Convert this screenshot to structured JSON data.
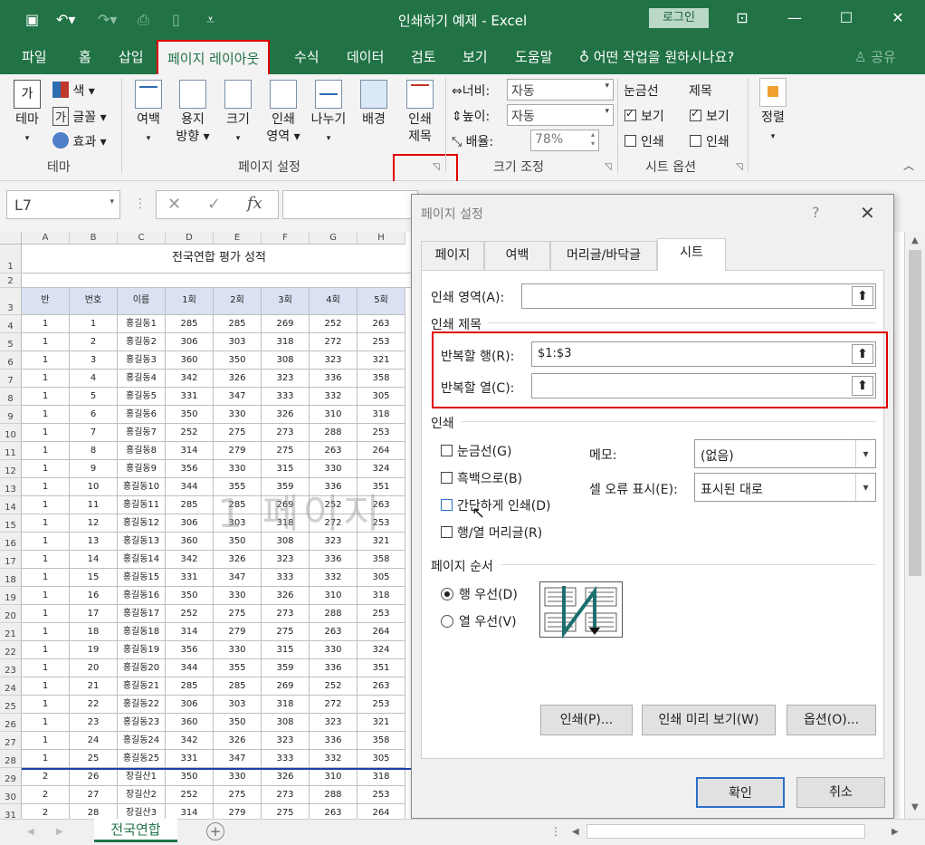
{
  "app": {
    "window_title": "인쇄하기 예제  -  Excel",
    "login": "로그인",
    "share": "공유"
  },
  "menu": {
    "tabs": [
      "파일",
      "홈",
      "삽입",
      "페이지 레이아웃",
      "수식",
      "데이터",
      "검토",
      "보기",
      "도움말"
    ],
    "tell_me": "어떤 작업을 원하시나요?"
  },
  "ribbon": {
    "theme": {
      "big": "테마",
      "color": "색",
      "font": "글꼴",
      "effect": "효과",
      "group": "테마",
      "font_glyph": "가"
    },
    "page_setup": {
      "margins": "여백",
      "orient_1": "용지",
      "orient_2": "방향",
      "size": "크기",
      "print_area_1": "인쇄",
      "print_area_2": "영역",
      "breaks": "나누기",
      "background": "배경",
      "titles_1": "인쇄",
      "titles_2": "제목",
      "group": "페이지 설정"
    },
    "scale": {
      "width_label": "너비:",
      "width_value": "자동",
      "height_label": "높이:",
      "height_value": "자동",
      "scale_label": "배율:",
      "scale_value": "78%",
      "group": "크기 조정"
    },
    "sheet_options": {
      "gridlines": "눈금선",
      "headings": "제목",
      "view": "보기",
      "print": "인쇄",
      "group": "시트 옵션"
    },
    "arrange": {
      "label": "정렬"
    }
  },
  "formula": {
    "name_box": "L7",
    "fx": "fx"
  },
  "sheet": {
    "columns": [
      "A",
      "B",
      "C",
      "D",
      "E",
      "F",
      "G",
      "H"
    ],
    "title": "전국연합 평가 성적",
    "headers": [
      "반",
      "번호",
      "이름",
      "1회",
      "2회",
      "3회",
      "4회",
      "5회"
    ],
    "rows": [
      [
        "1",
        "1",
        "홍길동1",
        "285",
        "285",
        "269",
        "252",
        "263"
      ],
      [
        "1",
        "2",
        "홍길동2",
        "306",
        "303",
        "318",
        "272",
        "253"
      ],
      [
        "1",
        "3",
        "홍길동3",
        "360",
        "350",
        "308",
        "323",
        "321"
      ],
      [
        "1",
        "4",
        "홍길동4",
        "342",
        "326",
        "323",
        "336",
        "358"
      ],
      [
        "1",
        "5",
        "홍길동5",
        "331",
        "347",
        "333",
        "332",
        "305"
      ],
      [
        "1",
        "6",
        "홍길동6",
        "350",
        "330",
        "326",
        "310",
        "318"
      ],
      [
        "1",
        "7",
        "홍길동7",
        "252",
        "275",
        "273",
        "288",
        "253"
      ],
      [
        "1",
        "8",
        "홍길동8",
        "314",
        "279",
        "275",
        "263",
        "264"
      ],
      [
        "1",
        "9",
        "홍길동9",
        "356",
        "330",
        "315",
        "330",
        "324"
      ],
      [
        "1",
        "10",
        "홍길동10",
        "344",
        "355",
        "359",
        "336",
        "351"
      ],
      [
        "1",
        "11",
        "홍길동11",
        "285",
        "285",
        "269",
        "252",
        "263"
      ],
      [
        "1",
        "12",
        "홍길동12",
        "306",
        "303",
        "318",
        "272",
        "253"
      ],
      [
        "1",
        "13",
        "홍길동13",
        "360",
        "350",
        "308",
        "323",
        "321"
      ],
      [
        "1",
        "14",
        "홍길동14",
        "342",
        "326",
        "323",
        "336",
        "358"
      ],
      [
        "1",
        "15",
        "홍길동15",
        "331",
        "347",
        "333",
        "332",
        "305"
      ],
      [
        "1",
        "16",
        "홍길동16",
        "350",
        "330",
        "326",
        "310",
        "318"
      ],
      [
        "1",
        "17",
        "홍길동17",
        "252",
        "275",
        "273",
        "288",
        "253"
      ],
      [
        "1",
        "18",
        "홍길동18",
        "314",
        "279",
        "275",
        "263",
        "264"
      ],
      [
        "1",
        "19",
        "홍길동19",
        "356",
        "330",
        "315",
        "330",
        "324"
      ],
      [
        "1",
        "20",
        "홍길동20",
        "344",
        "355",
        "359",
        "336",
        "351"
      ],
      [
        "1",
        "21",
        "홍길동21",
        "285",
        "285",
        "269",
        "252",
        "263"
      ],
      [
        "1",
        "22",
        "홍길동22",
        "306",
        "303",
        "318",
        "272",
        "253"
      ],
      [
        "1",
        "23",
        "홍길동23",
        "360",
        "350",
        "308",
        "323",
        "321"
      ],
      [
        "1",
        "24",
        "홍길동24",
        "342",
        "326",
        "323",
        "336",
        "358"
      ],
      [
        "1",
        "25",
        "홍길동25",
        "331",
        "347",
        "333",
        "332",
        "305"
      ],
      [
        "2",
        "26",
        "장길산1",
        "350",
        "330",
        "326",
        "310",
        "318"
      ],
      [
        "2",
        "27",
        "장길산2",
        "252",
        "275",
        "273",
        "288",
        "253"
      ],
      [
        "2",
        "28",
        "장길산3",
        "314",
        "279",
        "275",
        "263",
        "264"
      ]
    ],
    "row_numbers": [
      "1",
      "2",
      "3",
      "4",
      "5",
      "6",
      "7",
      "8",
      "9",
      "10",
      "11",
      "12",
      "13",
      "14",
      "15",
      "16",
      "17",
      "18",
      "19",
      "20",
      "21",
      "22",
      "23",
      "24",
      "25",
      "26",
      "27",
      "28",
      "29",
      "30",
      "31"
    ],
    "page_watermark": "1 페이지",
    "tab_name": "전국연합"
  },
  "dialog": {
    "title": "페이지 설정",
    "help": "?",
    "tabs": [
      "페이지",
      "여백",
      "머리글/바닥글",
      "시트"
    ],
    "print_area_label": "인쇄 영역(A):",
    "print_area_value": "",
    "print_titles_group": "인쇄 제목",
    "repeat_rows_label": "반복할 행(R):",
    "repeat_rows_value": "$1:$3",
    "repeat_cols_label": "반복할 열(C):",
    "repeat_cols_value": "",
    "print_group": "인쇄",
    "gridlines": "눈금선(G)",
    "black_white": "흑백으로(B)",
    "draft": "간단하게 인쇄(D)",
    "row_col_headings": "행/열 머리글(R)",
    "comments_label": "메모:",
    "comments_value": "(없음)",
    "cell_errors_label": "셀 오류 표시(E):",
    "cell_errors_value": "표시된 대로",
    "page_order_group": "페이지 순서",
    "down_then_over": "행 우선(D)",
    "over_then_down": "열 우선(V)",
    "btn_print": "인쇄(P)...",
    "btn_preview": "인쇄 미리 보기(W)",
    "btn_options": "옵션(O)...",
    "btn_ok": "확인",
    "btn_cancel": "취소"
  }
}
